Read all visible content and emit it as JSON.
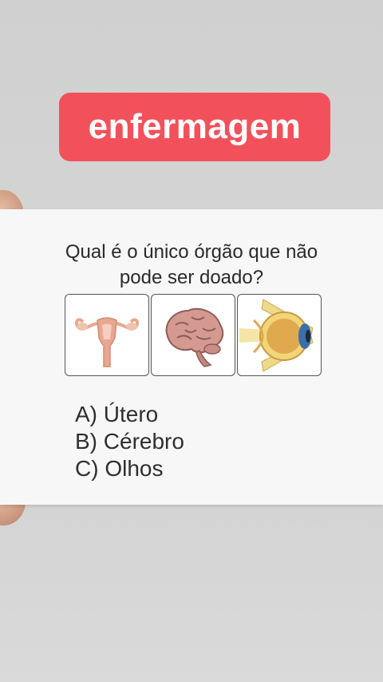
{
  "tag": {
    "label": "enfermagem"
  },
  "card": {
    "question_line1": "Qual é o único órgão que não",
    "question_line2": "pode ser doado?",
    "images": [
      "uterus-icon",
      "brain-icon",
      "eye-icon"
    ],
    "answers": [
      "A) Útero",
      "B) Cérebro",
      "C) Olhos"
    ]
  },
  "colors": {
    "tag_background": "#f2515b",
    "tag_text": "#ffffff",
    "card": "#f7f7f8"
  }
}
